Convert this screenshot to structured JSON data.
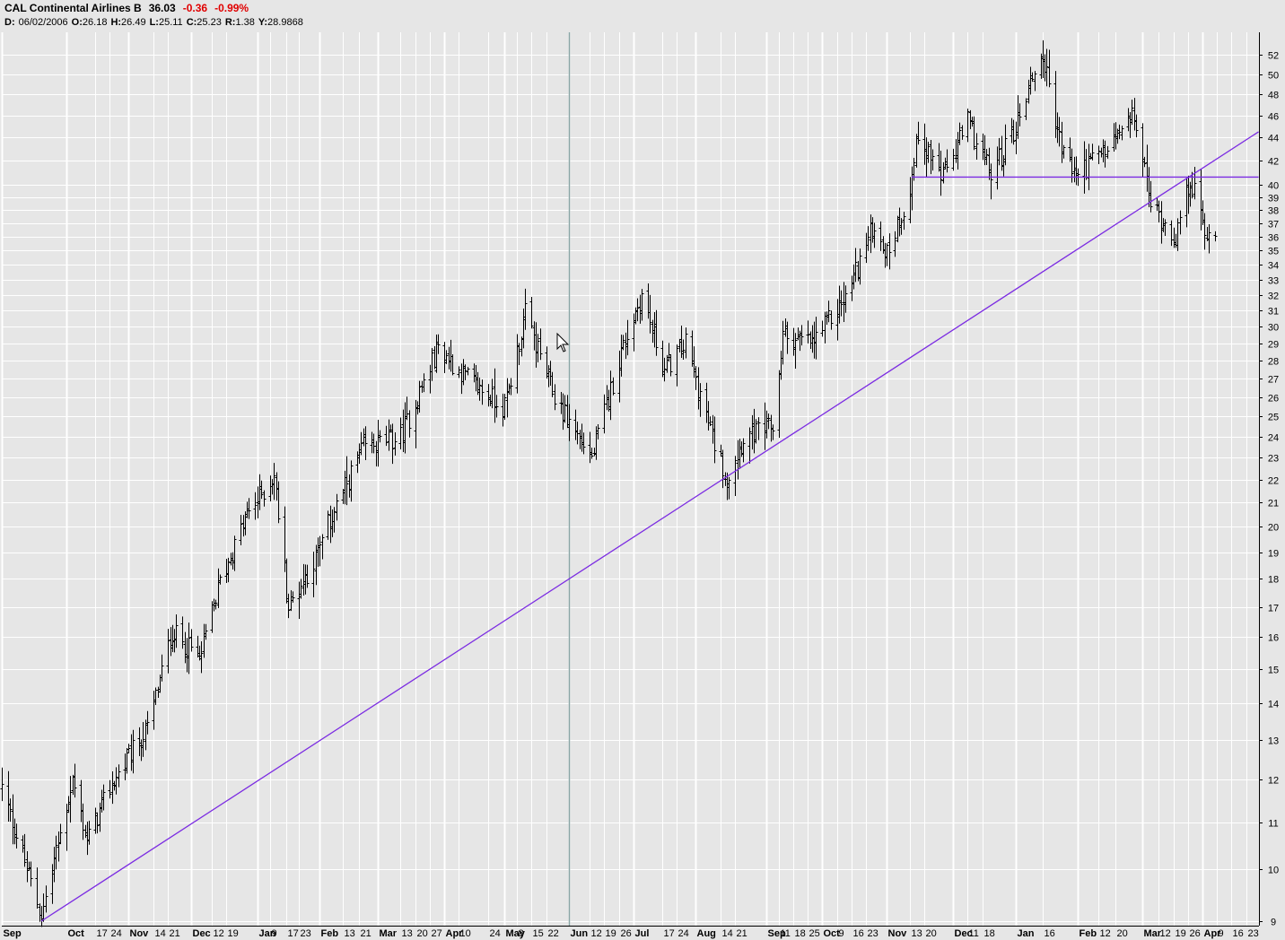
{
  "header": {
    "symbol_line": "CAL Continental Airlines B",
    "last": "36.03",
    "change": "-0.36",
    "change_pct": "-0.99%",
    "ohlc_line": {
      "date_label": "D:",
      "date": "06/02/2006",
      "open_label": "O:",
      "open": "26.18",
      "high_label": "H:",
      "high": "26.49",
      "low_label": "L:",
      "low": "25.11",
      "close_label": "C:",
      "close": "25.23",
      "range_label": "R:",
      "range": "1.38",
      "y_label": "Y:",
      "y": "28.9868"
    }
  },
  "colors": {
    "background": "#e6e6e6",
    "grid": "#ffffff",
    "bars": "#000000",
    "trendline": "#7b2be2",
    "crosshair": "#8aa6a6",
    "negative": "#e00000"
  },
  "chart_data": {
    "type": "ohlc-bar",
    "y_scale": "log",
    "ylim": [
      9,
      53
    ],
    "x_range": [
      "2006-09-01",
      "2008-04-28"
    ],
    "grid": true,
    "y_ticks": [
      9,
      10,
      11,
      12,
      13,
      14,
      15,
      16,
      17,
      18,
      19,
      20,
      21,
      22,
      23,
      24,
      25,
      26,
      27,
      28,
      29,
      30,
      31,
      32,
      33,
      34,
      35,
      36,
      37,
      38,
      39,
      40,
      42,
      44,
      46,
      48,
      50,
      52
    ],
    "x_ticks": [
      {
        "date": "2006-09-01",
        "label": "Sep",
        "bold": true
      },
      {
        "date": "2006-10-02",
        "label": "Oct",
        "bold": true
      },
      {
        "date": "2006-10-16",
        "label": "17",
        "bold": false
      },
      {
        "date": "2006-10-23",
        "label": "24",
        "bold": false
      },
      {
        "date": "2006-11-01",
        "label": "Nov",
        "bold": true
      },
      {
        "date": "2006-11-13",
        "label": "14",
        "bold": false
      },
      {
        "date": "2006-11-20",
        "label": "21",
        "bold": false
      },
      {
        "date": "2006-12-01",
        "label": "Dec",
        "bold": true
      },
      {
        "date": "2006-12-11",
        "label": "12",
        "bold": false
      },
      {
        "date": "2006-12-18",
        "label": "19",
        "bold": false
      },
      {
        "date": "2007-01-02",
        "label": "Jan",
        "bold": true
      },
      {
        "date": "2007-01-08",
        "label": "9",
        "bold": false
      },
      {
        "date": "2007-01-16",
        "label": "17",
        "bold": false
      },
      {
        "date": "2007-01-22",
        "label": "23",
        "bold": false
      },
      {
        "date": "2007-02-01",
        "label": "Feb",
        "bold": true
      },
      {
        "date": "2007-02-12",
        "label": "13",
        "bold": false
      },
      {
        "date": "2007-02-20",
        "label": "21",
        "bold": false
      },
      {
        "date": "2007-03-01",
        "label": "Mar",
        "bold": true
      },
      {
        "date": "2007-03-12",
        "label": "13",
        "bold": false
      },
      {
        "date": "2007-03-19",
        "label": "20",
        "bold": false
      },
      {
        "date": "2007-03-26",
        "label": "27",
        "bold": false
      },
      {
        "date": "2007-04-02",
        "label": "Apr",
        "bold": true
      },
      {
        "date": "2007-04-09",
        "label": "10",
        "bold": false
      },
      {
        "date": "2007-04-23",
        "label": "24",
        "bold": false
      },
      {
        "date": "2007-05-01",
        "label": "May",
        "bold": true
      },
      {
        "date": "2007-05-07",
        "label": "8",
        "bold": false
      },
      {
        "date": "2007-05-14",
        "label": "15",
        "bold": false
      },
      {
        "date": "2007-05-21",
        "label": "22",
        "bold": false
      },
      {
        "date": "2007-06-01",
        "label": "Jun",
        "bold": true
      },
      {
        "date": "2007-06-11",
        "label": "12",
        "bold": false
      },
      {
        "date": "2007-06-18",
        "label": "19",
        "bold": false
      },
      {
        "date": "2007-06-25",
        "label": "26",
        "bold": false
      },
      {
        "date": "2007-07-02",
        "label": "Jul",
        "bold": true
      },
      {
        "date": "2007-07-16",
        "label": "17",
        "bold": false
      },
      {
        "date": "2007-07-23",
        "label": "24",
        "bold": false
      },
      {
        "date": "2007-08-01",
        "label": "Aug",
        "bold": true
      },
      {
        "date": "2007-08-13",
        "label": "14",
        "bold": false
      },
      {
        "date": "2007-08-20",
        "label": "21",
        "bold": false
      },
      {
        "date": "2007-09-04",
        "label": "Sep",
        "bold": true
      },
      {
        "date": "2007-09-10",
        "label": "11",
        "bold": false
      },
      {
        "date": "2007-09-17",
        "label": "18",
        "bold": false
      },
      {
        "date": "2007-09-24",
        "label": "25",
        "bold": false
      },
      {
        "date": "2007-10-01",
        "label": "Oct",
        "bold": true
      },
      {
        "date": "2007-10-08",
        "label": "9",
        "bold": false
      },
      {
        "date": "2007-10-15",
        "label": "16",
        "bold": false
      },
      {
        "date": "2007-10-22",
        "label": "23",
        "bold": false
      },
      {
        "date": "2007-11-01",
        "label": "Nov",
        "bold": true
      },
      {
        "date": "2007-11-12",
        "label": "13",
        "bold": false
      },
      {
        "date": "2007-11-19",
        "label": "20",
        "bold": false
      },
      {
        "date": "2007-12-03",
        "label": "Dec",
        "bold": true
      },
      {
        "date": "2007-12-10",
        "label": "11",
        "bold": false
      },
      {
        "date": "2007-12-17",
        "label": "18",
        "bold": false
      },
      {
        "date": "2008-01-02",
        "label": "Jan",
        "bold": true
      },
      {
        "date": "2008-01-15",
        "label": "16",
        "bold": false
      },
      {
        "date": "2008-02-01",
        "label": "Feb",
        "bold": true
      },
      {
        "date": "2008-02-11",
        "label": "12",
        "bold": false
      },
      {
        "date": "2008-02-19",
        "label": "20",
        "bold": false
      },
      {
        "date": "2008-03-03",
        "label": "Mar",
        "bold": true
      },
      {
        "date": "2008-03-11",
        "label": "12",
        "bold": false
      },
      {
        "date": "2008-03-18",
        "label": "19",
        "bold": false
      },
      {
        "date": "2008-03-25",
        "label": "26",
        "bold": false
      },
      {
        "date": "2008-04-01",
        "label": "Apr",
        "bold": true
      },
      {
        "date": "2008-04-08",
        "label": "9",
        "bold": false
      },
      {
        "date": "2008-04-15",
        "label": "16",
        "bold": false
      },
      {
        "date": "2008-04-22",
        "label": "23",
        "bold": false
      }
    ],
    "price_path": [
      {
        "date": "2006-09-01",
        "close": 11.8
      },
      {
        "date": "2006-09-20",
        "close": 9.1
      },
      {
        "date": "2006-10-05",
        "close": 12.0
      },
      {
        "date": "2006-10-12",
        "close": 10.6
      },
      {
        "date": "2006-10-24",
        "close": 11.9
      },
      {
        "date": "2006-11-10",
        "close": 13.3
      },
      {
        "date": "2006-11-22",
        "close": 16.2
      },
      {
        "date": "2006-12-05",
        "close": 15.3
      },
      {
        "date": "2006-12-15",
        "close": 17.9
      },
      {
        "date": "2006-12-28",
        "close": 20.5
      },
      {
        "date": "2007-01-10",
        "close": 22.2
      },
      {
        "date": "2007-01-17",
        "close": 17.0
      },
      {
        "date": "2007-01-30",
        "close": 18.8
      },
      {
        "date": "2007-02-07",
        "close": 20.5
      },
      {
        "date": "2007-02-22",
        "close": 23.5
      },
      {
        "date": "2007-03-12",
        "close": 24.0
      },
      {
        "date": "2007-03-30",
        "close": 28.8
      },
      {
        "date": "2007-04-15",
        "close": 26.8
      },
      {
        "date": "2007-05-01",
        "close": 25.5
      },
      {
        "date": "2007-05-11",
        "close": 30.8
      },
      {
        "date": "2007-05-25",
        "close": 26.0
      },
      {
        "date": "2007-06-12",
        "close": 23.0
      },
      {
        "date": "2007-06-26",
        "close": 28.5
      },
      {
        "date": "2007-07-06",
        "close": 32.0
      },
      {
        "date": "2007-07-17",
        "close": 27.5
      },
      {
        "date": "2007-07-27",
        "close": 29.0
      },
      {
        "date": "2007-08-09",
        "close": 24.0
      },
      {
        "date": "2007-08-16",
        "close": 22.1
      },
      {
        "date": "2007-08-24",
        "close": 24.0
      },
      {
        "date": "2007-09-07",
        "close": 24.5
      },
      {
        "date": "2007-09-12",
        "close": 29.5
      },
      {
        "date": "2007-09-26",
        "close": 29.0
      },
      {
        "date": "2007-10-12",
        "close": 31.8
      },
      {
        "date": "2007-10-26",
        "close": 37.0
      },
      {
        "date": "2007-11-01",
        "close": 34.8
      },
      {
        "date": "2007-11-12",
        "close": 39.5
      },
      {
        "date": "2007-11-16",
        "close": 44.5
      },
      {
        "date": "2007-11-28",
        "close": 40.5
      },
      {
        "date": "2007-12-10",
        "close": 45.5
      },
      {
        "date": "2007-12-21",
        "close": 40.8
      },
      {
        "date": "2008-01-02",
        "close": 45.0
      },
      {
        "date": "2008-01-10",
        "close": 50.0
      },
      {
        "date": "2008-01-15",
        "close": 52.0
      },
      {
        "date": "2008-01-24",
        "close": 43.0
      },
      {
        "date": "2008-01-31",
        "close": 40.8
      },
      {
        "date": "2008-02-15",
        "close": 43.0
      },
      {
        "date": "2008-02-28",
        "close": 46.0
      },
      {
        "date": "2008-03-07",
        "close": 38.5
      },
      {
        "date": "2008-03-19",
        "close": 36.0
      },
      {
        "date": "2008-03-26",
        "close": 40.5
      },
      {
        "date": "2008-04-02",
        "close": 36.5
      },
      {
        "date": "2008-04-07",
        "close": 36.0
      }
    ],
    "trendlines": [
      {
        "name": "rising-trendline",
        "from": {
          "date": "2006-09-20",
          "price": 9.0
        },
        "to": {
          "date": "2008-04-28",
          "price": 44.5
        }
      },
      {
        "name": "horizontal-support",
        "from": {
          "date": "2007-11-13",
          "price": 40.6
        },
        "to": {
          "date": "2008-04-28",
          "price": 40.6
        }
      }
    ],
    "crosshair_date": "2007-06-01"
  }
}
